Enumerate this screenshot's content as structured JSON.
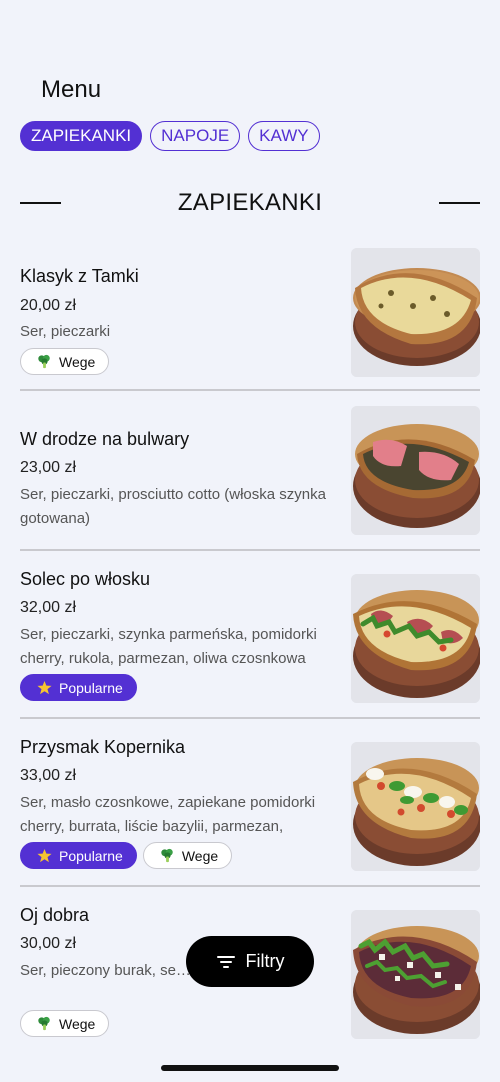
{
  "header": {
    "title": "Menu"
  },
  "tabs": [
    {
      "label": "ZAPIEKANKI",
      "active": true
    },
    {
      "label": "NAPOJE",
      "active": false
    },
    {
      "label": "KAWY",
      "active": false
    }
  ],
  "section": {
    "title": "ZAPIEKANKI"
  },
  "tag_labels": {
    "vege": "Wege",
    "popular": "Popularne"
  },
  "items": [
    {
      "name": "Klasyk z Tamki",
      "price": "20,00 zł",
      "description": "Ser, pieczarki",
      "tags": [
        "vege"
      ],
      "image": "zapiekanka-cheese-mushroom-photo"
    },
    {
      "name": "W drodze na bulwary",
      "price": "23,00 zł",
      "description": "Ser, pieczarki, prosciutto cotto (włoska szynka gotowana)",
      "tags": [],
      "image": "zapiekanka-ham-photo"
    },
    {
      "name": "Solec po włosku",
      "price": "32,00 zł",
      "description": "Ser, pieczarki, szynka parmeńska, pomidorki cherry, rukola, parmezan, oliwa czosnkowa",
      "tags": [
        "popular"
      ],
      "image": "zapiekanka-parma-ham-arugula-photo"
    },
    {
      "name": "Przysmak Kopernika",
      "price": "33,00 zł",
      "description": "Ser, masło czosnkowe, zapiekane pomidorki cherry, burrata, liście bazylii, parmezan,",
      "tags": [
        "popular",
        "vege"
      ],
      "image": "zapiekanka-burrata-basil-photo"
    },
    {
      "name": "Oj dobra",
      "price": "30,00 zł",
      "description": "Ser, pieczony burak, se… …zechy włoskie",
      "tags": [
        "vege"
      ],
      "image": "zapiekanka-beetroot-photo"
    }
  ],
  "filter_button": {
    "label": "Filtry",
    "icon": "filter-lines-icon"
  },
  "colors": {
    "accent": "#5330d3",
    "background": "#f1f3fa"
  },
  "icons": {
    "vege": "broccoli-icon",
    "popular": "star-icon"
  }
}
